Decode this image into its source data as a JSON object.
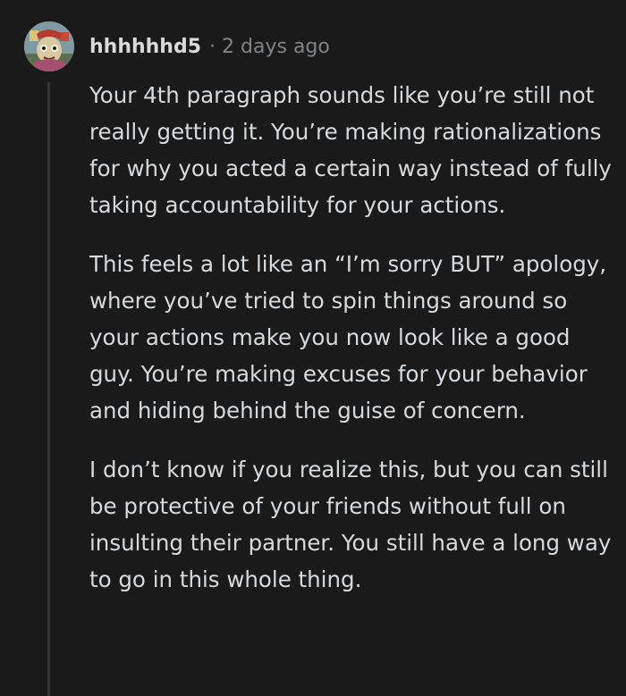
{
  "comment": {
    "author": "hhhhhhd5",
    "separator": "·",
    "timestamp": "2 days ago",
    "avatar_icon": "user-avatar-icon",
    "paragraphs": [
      "Your 4th paragraph sounds like you’re still not really getting it. You’re making rationalizations for why you acted a certain way instead of fully taking accountability for your actions.",
      "This feels a lot like an “I’m sorry BUT” apology, where you’ve tried to spin things around so your actions make you now look like a good guy. You’re making excuses for your behavior and hiding behind the guise of concern.",
      "I don’t know if you realize this, but you can still be protective of your friends without full on insulting their partner. You still have a long way to go in this whole thing."
    ]
  },
  "colors": {
    "background": "#1a1a1b",
    "text": "#d7dadc",
    "meta_text": "#818384",
    "thread_line": "#343536"
  }
}
